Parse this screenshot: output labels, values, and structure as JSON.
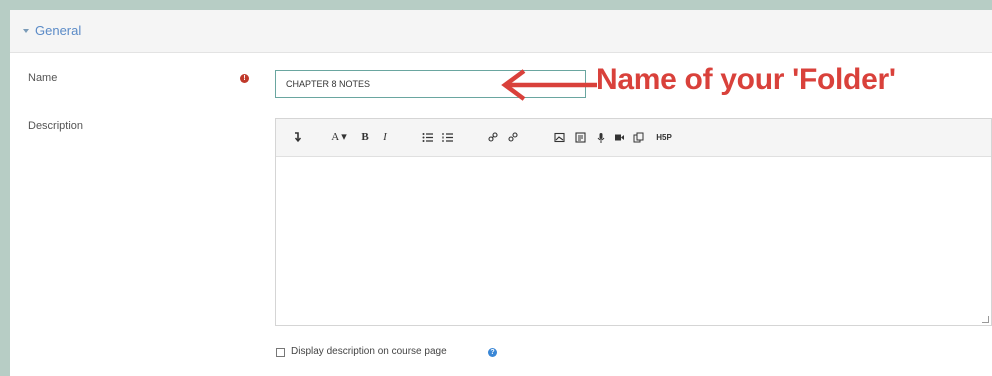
{
  "section": {
    "title": "General"
  },
  "fields": {
    "name_label": "Name",
    "name_value": "CHAPTER 8 NOTES",
    "required_icon": "!",
    "description_label": "Description"
  },
  "editor_toolbar": {
    "buttons": [
      {
        "icon": "collapse-icon",
        "glyph": "↴"
      },
      {
        "icon": "font-style-icon",
        "glyph": "A ▾"
      },
      {
        "icon": "bold-icon",
        "glyph": "B"
      },
      {
        "icon": "italic-icon",
        "glyph": "I"
      },
      {
        "icon": "unordered-list-icon",
        "glyph": "☰"
      },
      {
        "icon": "ordered-list-icon",
        "glyph": "☰"
      },
      {
        "icon": "link-icon",
        "glyph": "🔗"
      },
      {
        "icon": "unlink-icon",
        "glyph": "⛓"
      },
      {
        "icon": "image-icon",
        "glyph": "▣"
      },
      {
        "icon": "media-icon",
        "glyph": "▤"
      },
      {
        "icon": "microphone-icon",
        "glyph": "🎙"
      },
      {
        "icon": "video-icon",
        "glyph": "■"
      },
      {
        "icon": "manage-files-icon",
        "glyph": "⧉"
      },
      {
        "icon": "h5p-icon",
        "glyph": "H5P"
      }
    ]
  },
  "display_description": {
    "label": "Display description on course page",
    "help_icon": "?"
  },
  "annotation": {
    "text": "Name of your 'Folder'",
    "color": "#d9413b"
  }
}
